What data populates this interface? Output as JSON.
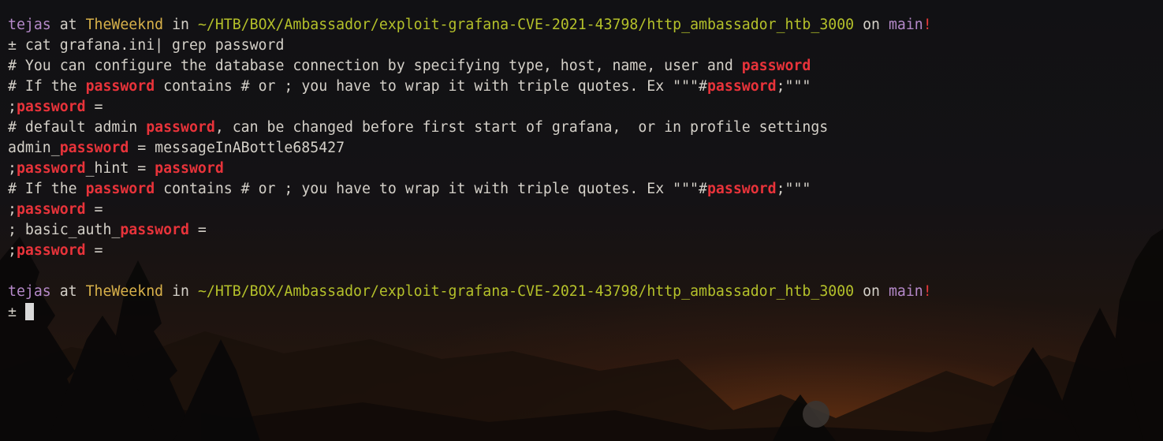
{
  "window": {
    "kind": "terminal"
  },
  "colors": {
    "default_text": "#d4d0c8",
    "user": "#b589c9",
    "host": "#d8b14a",
    "path": "#b4c02a",
    "branch": "#b589c9",
    "dirty": "#e83a3a",
    "match": "#e8333a",
    "cursor": "#d9d9d9"
  },
  "terminal": {
    "lines": [
      [
        {
          "text": "tejas",
          "color": "#b589c9"
        },
        {
          "text": " at ",
          "color": "#d4d0c8"
        },
        {
          "text": "TheWeeknd",
          "color": "#d8b14a"
        },
        {
          "text": " in ",
          "color": "#d4d0c8"
        },
        {
          "text": "~/HTB/BOX/Ambassador/exploit-grafana-CVE-2021-43798/http_ambassador_htb_3000",
          "color": "#b4c02a"
        },
        {
          "text": " on ",
          "color": "#d4d0c8"
        },
        {
          "text": "main",
          "color": "#b589c9"
        },
        {
          "text": "!",
          "color": "#e83a3a"
        }
      ],
      [
        {
          "text": "± cat grafana.ini| grep password",
          "color": "#d4d0c8"
        }
      ],
      [
        {
          "text": "# You can configure the database connection by specifying type, host, name, user and ",
          "color": "#d4d0c8"
        },
        {
          "text": "password",
          "color": "#e8333a",
          "bold": true
        }
      ],
      [
        {
          "text": "# If the ",
          "color": "#d4d0c8"
        },
        {
          "text": "password",
          "color": "#e8333a",
          "bold": true
        },
        {
          "text": " contains # or ; you have to wrap it with triple quotes. Ex \"\"\"#",
          "color": "#d4d0c8"
        },
        {
          "text": "password",
          "color": "#e8333a",
          "bold": true
        },
        {
          "text": ";\"\"\"",
          "color": "#d4d0c8"
        }
      ],
      [
        {
          "text": ";",
          "color": "#d4d0c8"
        },
        {
          "text": "password",
          "color": "#e8333a",
          "bold": true
        },
        {
          "text": " =",
          "color": "#d4d0c8"
        }
      ],
      [
        {
          "text": "# default admin ",
          "color": "#d4d0c8"
        },
        {
          "text": "password",
          "color": "#e8333a",
          "bold": true
        },
        {
          "text": ", can be changed before first start of grafana,  or in profile settings",
          "color": "#d4d0c8"
        }
      ],
      [
        {
          "text": "admin_",
          "color": "#d4d0c8"
        },
        {
          "text": "password",
          "color": "#e8333a",
          "bold": true
        },
        {
          "text": " = messageInABottle685427",
          "color": "#d4d0c8"
        }
      ],
      [
        {
          "text": ";",
          "color": "#d4d0c8"
        },
        {
          "text": "password",
          "color": "#e8333a",
          "bold": true
        },
        {
          "text": "_hint = ",
          "color": "#d4d0c8"
        },
        {
          "text": "password",
          "color": "#e8333a",
          "bold": true
        }
      ],
      [
        {
          "text": "# If the ",
          "color": "#d4d0c8"
        },
        {
          "text": "password",
          "color": "#e8333a",
          "bold": true
        },
        {
          "text": " contains # or ; you have to wrap it with triple quotes. Ex \"\"\"#",
          "color": "#d4d0c8"
        },
        {
          "text": "password",
          "color": "#e8333a",
          "bold": true
        },
        {
          "text": ";\"\"\"",
          "color": "#d4d0c8"
        }
      ],
      [
        {
          "text": ";",
          "color": "#d4d0c8"
        },
        {
          "text": "password",
          "color": "#e8333a",
          "bold": true
        },
        {
          "text": " =",
          "color": "#d4d0c8"
        }
      ],
      [
        {
          "text": "; basic_auth_",
          "color": "#d4d0c8"
        },
        {
          "text": "password",
          "color": "#e8333a",
          "bold": true
        },
        {
          "text": " =",
          "color": "#d4d0c8"
        }
      ],
      [
        {
          "text": ";",
          "color": "#d4d0c8"
        },
        {
          "text": "password",
          "color": "#e8333a",
          "bold": true
        },
        {
          "text": " =",
          "color": "#d4d0c8"
        }
      ],
      [],
      [
        {
          "text": "tejas",
          "color": "#b589c9"
        },
        {
          "text": " at ",
          "color": "#d4d0c8"
        },
        {
          "text": "TheWeeknd",
          "color": "#d8b14a"
        },
        {
          "text": " in ",
          "color": "#d4d0c8"
        },
        {
          "text": "~/HTB/BOX/Ambassador/exploit-grafana-CVE-2021-43798/http_ambassador_htb_3000",
          "color": "#b4c02a"
        },
        {
          "text": " on ",
          "color": "#d4d0c8"
        },
        {
          "text": "main",
          "color": "#b589c9"
        },
        {
          "text": "!",
          "color": "#e83a3a"
        }
      ],
      [
        {
          "text": "± ",
          "color": "#d4d0c8"
        }
      ]
    ],
    "cursor_line": 14
  }
}
